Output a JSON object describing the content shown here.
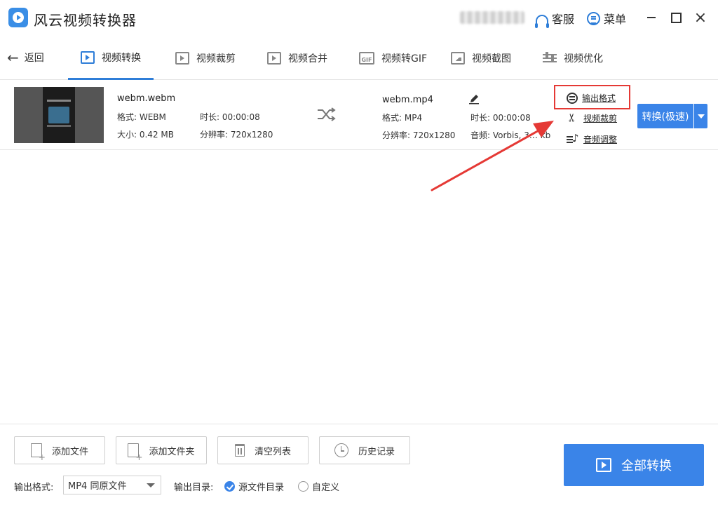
{
  "app": {
    "title": "风云视频转换器"
  },
  "titlebar": {
    "service_label": "客服",
    "menu_label": "菜单",
    "close_glyph": "×"
  },
  "nav": {
    "back_label": "返回",
    "tabs": [
      {
        "label": "视频转换",
        "icon": "video-convert-icon",
        "active": true
      },
      {
        "label": "视频裁剪",
        "icon": "video-crop-icon",
        "active": false
      },
      {
        "label": "视频合并",
        "icon": "video-merge-icon",
        "active": false
      },
      {
        "label": "视频转GIF",
        "icon": "gif-icon",
        "active": false
      },
      {
        "label": "视频截图",
        "icon": "screenshot-icon",
        "active": false
      },
      {
        "label": "视频优化",
        "icon": "sliders-icon",
        "active": false
      }
    ],
    "gif_badge": "GIF"
  },
  "file": {
    "source": {
      "name": "webm.webm",
      "format": "格式: WEBM",
      "duration": "时长: 00:00:08",
      "size": "大小: 0.42 MB",
      "resolution": "分辨率: 720x1280"
    },
    "output": {
      "name": "webm.mp4",
      "format": "格式: MP4",
      "duration": "时长: 00:00:08",
      "resolution": "分辨率: 720x1280",
      "audio": "音频: Vorbis, 3… kb"
    },
    "actions": {
      "output_format": "输出格式",
      "video_crop": "视频裁剪",
      "audio_adjust": "音频调整"
    },
    "convert_label": "转换(极速)"
  },
  "bottom": {
    "add_file": "添加文件",
    "add_folder": "添加文件夹",
    "clear_list": "清空列表",
    "history": "历史记录",
    "convert_all": "全部转换",
    "output_format_label": "输出格式:",
    "output_format_value": "MP4 同原文件",
    "output_dir_label": "输出目录:",
    "dir_source": "源文件目录",
    "dir_custom": "自定义"
  },
  "colors": {
    "accent": "#3a84e8",
    "highlight": "#e53935"
  }
}
